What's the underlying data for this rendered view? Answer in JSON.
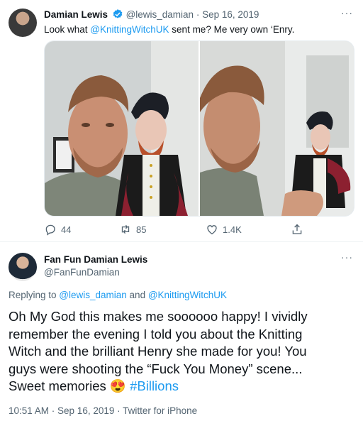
{
  "tweet": {
    "author_name": "Damian Lewis",
    "handle": "@lewis_damian",
    "separator": "·",
    "date": "Sep 16, 2019",
    "text_prefix": "Look what ",
    "text_mention": "@KnittingWitchUK",
    "text_suffix": " sent me? Me very own ‘Enry.",
    "more": "···",
    "actions": {
      "reply_count": "44",
      "retweet_count": "85",
      "like_count": "1.4K"
    }
  },
  "reply": {
    "author_name": "Fan Fun Damian Lewis",
    "handle": "@FanFunDamian",
    "more": "···",
    "replying_prefix": "Replying to ",
    "replying_user1": "@lewis_damian",
    "replying_and": " and ",
    "replying_user2": "@KnittingWitchUK",
    "text_line1": "Oh My God this makes me soooooo happy! I vividly",
    "text_line2": "remember the evening I told you about the Knitting",
    "text_line3": "Witch and the brilliant Henry she made for you! You",
    "text_line4": "guys were shooting the “Fuck You Money” scene...",
    "text_line5_prefix": "Sweet memories ",
    "emoji": "😍",
    "hashtag": " #Billions",
    "timestamp": "10:51 AM · Sep 16, 2019 · Twitter for iPhone"
  },
  "colors": {
    "link": "#1d9bf0",
    "verified": "#1d9bf0",
    "secondary_text": "#536471"
  }
}
